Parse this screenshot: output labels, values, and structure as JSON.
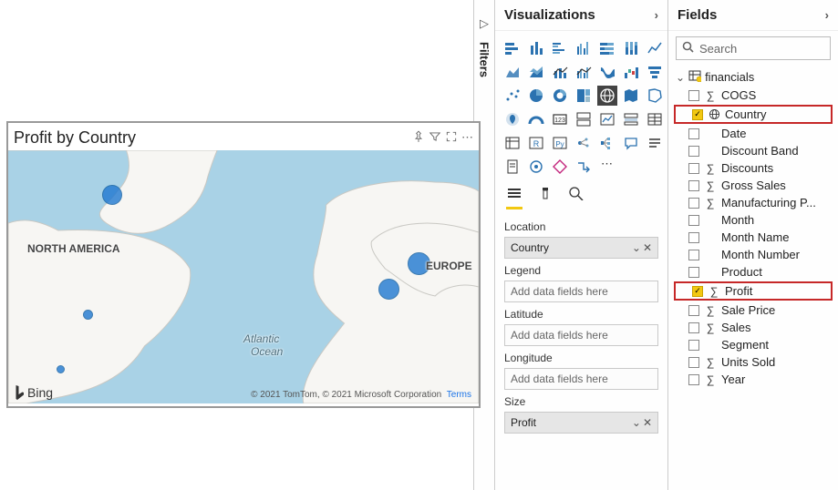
{
  "panels": {
    "filters_label": "Filters",
    "visualizations_label": "Visualizations",
    "fields_label": "Fields"
  },
  "visual": {
    "title": "Profit by Country",
    "attribution_text": "© 2021 TomTom, © 2021 Microsoft Corporation",
    "terms_text": "Terms",
    "bing_label": "Bing",
    "map_labels": {
      "north_america": "NORTH AMERICA",
      "europe": "EUROPE",
      "atlantic": "Atlantic",
      "ocean": "Ocean"
    }
  },
  "wells": {
    "location_label": "Location",
    "location_value": "Country",
    "legend_label": "Legend",
    "latitude_label": "Latitude",
    "longitude_label": "Longitude",
    "size_label": "Size",
    "size_value": "Profit",
    "placeholder": "Add data fields here"
  },
  "fields_panel": {
    "search_placeholder": "Search",
    "table_name": "financials",
    "fields": [
      {
        "name": "COGS",
        "checked": false,
        "sigma": true,
        "icon": ""
      },
      {
        "name": "Country",
        "checked": true,
        "sigma": false,
        "icon": "globe",
        "hl": true
      },
      {
        "name": "Date",
        "checked": false,
        "sigma": false,
        "icon": ""
      },
      {
        "name": "Discount Band",
        "checked": false,
        "sigma": false,
        "icon": ""
      },
      {
        "name": "Discounts",
        "checked": false,
        "sigma": true,
        "icon": ""
      },
      {
        "name": "Gross Sales",
        "checked": false,
        "sigma": true,
        "icon": ""
      },
      {
        "name": "Manufacturing P...",
        "checked": false,
        "sigma": true,
        "icon": ""
      },
      {
        "name": "Month",
        "checked": false,
        "sigma": false,
        "icon": ""
      },
      {
        "name": "Month Name",
        "checked": false,
        "sigma": false,
        "icon": ""
      },
      {
        "name": "Month Number",
        "checked": false,
        "sigma": false,
        "icon": ""
      },
      {
        "name": "Product",
        "checked": false,
        "sigma": false,
        "icon": ""
      },
      {
        "name": "Profit",
        "checked": true,
        "sigma": true,
        "icon": "",
        "hl": true
      },
      {
        "name": "Sale Price",
        "checked": false,
        "sigma": true,
        "icon": ""
      },
      {
        "name": "Sales",
        "checked": false,
        "sigma": true,
        "icon": ""
      },
      {
        "name": "Segment",
        "checked": false,
        "sigma": false,
        "icon": ""
      },
      {
        "name": "Units Sold",
        "checked": false,
        "sigma": true,
        "icon": ""
      },
      {
        "name": "Year",
        "checked": false,
        "sigma": true,
        "icon": ""
      }
    ]
  },
  "chart_data": {
    "type": "map",
    "title": "Profit by Country",
    "location_field": "Country",
    "size_field": "Profit",
    "notes": "Bubble sizes are estimated relative values read from the map; no axis scale is shown.",
    "points": [
      {
        "country": "Canada",
        "approx_lat": 55,
        "approx_lon": -100,
        "relative_size": 55
      },
      {
        "country": "USA",
        "approx_lat": 38,
        "approx_lon": -101,
        "relative_size": 15
      },
      {
        "country": "Mexico",
        "approx_lat": 21,
        "approx_lon": -102,
        "relative_size": 10
      },
      {
        "country": "France",
        "approx_lat": 47,
        "approx_lon": 3,
        "relative_size": 60
      },
      {
        "country": "Germany",
        "approx_lat": 51,
        "approx_lon": 10,
        "relative_size": 65
      }
    ]
  }
}
